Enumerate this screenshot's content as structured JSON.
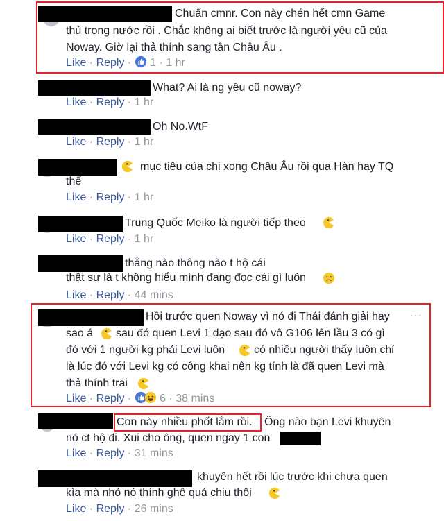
{
  "colors": {
    "link": "#365899",
    "meta": "#90949c",
    "highlight": "#e4262c",
    "redaction": "#000000"
  },
  "comments": [
    {
      "lines": [
        "Chuẩn cmnr. Con này chén hết cmn Game",
        "thủ trong nước rồi . Chắc không ai biết trước là người yêu cũ của",
        "Noway. Giờ lại thả thính sang tân Châu Âu ."
      ],
      "like": "Like",
      "reply": "Reply",
      "reactions": "1",
      "time": "1 hr",
      "reaction_icons": [
        "like-icon"
      ]
    },
    {
      "lines": [
        "What? Ai là ng yêu cũ noway?"
      ],
      "like": "Like",
      "reply": "Reply",
      "time": "1 hr"
    },
    {
      "lines": [
        "Oh No.WtF"
      ],
      "like": "Like",
      "reply": "Reply",
      "time": "1 hr"
    },
    {
      "lines": [
        "mục tiêu của chị xong Châu Âu rồi qua Hàn hay TQ",
        "thể"
      ],
      "like": "Like",
      "reply": "Reply",
      "time": "1 hr",
      "emoji": "pacman-icon"
    },
    {
      "lines": [
        "Trung Quốc Meiko là người tiếp theo"
      ],
      "like": "Like",
      "reply": "Reply",
      "time": "1 hr",
      "emoji": "pacman-icon"
    },
    {
      "lines": [
        "thằng nào thông não t hộ cái",
        "thật sự là t không hiểu mình đang đọc cái gì luôn"
      ],
      "like": "Like",
      "reply": "Reply",
      "time": "44 mins",
      "emoji": "confused-icon"
    },
    {
      "lines": [
        "Hồi trước quen Noway vì nó đi Thái đánh giải hay",
        "sao á",
        "sau đó quen Levi 1 dạo sau đó vô G106 lên lầu 3 có gì",
        "đó với 1 người kg phải Levi luôn",
        "có nhiều người thấy luôn chỉ",
        "là lúc đó với Levi kg có công khai nên kg tính là đã quen Levi mà",
        "thả thính trai"
      ],
      "like": "Like",
      "reply": "Reply",
      "reactions": "6",
      "time": "38 mins",
      "reaction_icons": [
        "like-icon",
        "haha-icon"
      ],
      "more": "···"
    },
    {
      "lines": [
        "Con này nhiều phốt lắm rồi.",
        "Ông nào bạn Levi khuyên",
        "nó ct hộ đi. Xui cho ông, quen ngay 1 con"
      ],
      "like": "Like",
      "reply": "Reply",
      "time": "31 mins"
    },
    {
      "lines": [
        "khuyên hết rồi lúc trước khi chưa quen",
        "kìa mà nhỏ nó thính ghê quá chịu thôi"
      ],
      "like": "Like",
      "reply": "Reply",
      "time": "26 mins",
      "emoji": "pacman-icon"
    }
  ]
}
